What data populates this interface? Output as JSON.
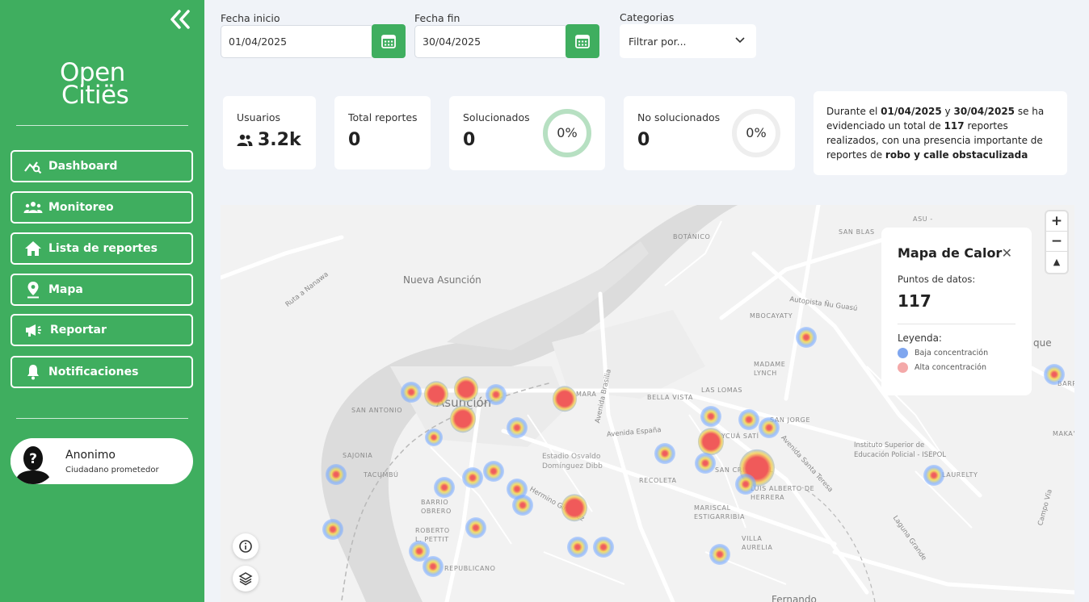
{
  "sidebar": {
    "logo_line1": "Open",
    "logo_line2": "Citiës",
    "items": [
      {
        "label": "Dashboard",
        "icon": "chart-search-icon"
      },
      {
        "label": "Monitoreo",
        "icon": "users-icon"
      },
      {
        "label": "Lista de reportes",
        "icon": "home-icon"
      },
      {
        "label": "Mapa",
        "icon": "map-pin-icon"
      },
      {
        "label": "Reportar",
        "icon": "megaphone-icon"
      },
      {
        "label": "Notificaciones",
        "icon": "bell-icon"
      }
    ],
    "user": {
      "name": "Anonimo",
      "role": "Ciudadano prometedor"
    }
  },
  "filters": {
    "start_label": "Fecha inicio",
    "start_value": "01/04/2025",
    "end_label": "Fecha fin",
    "end_value": "30/04/2025",
    "category_label": "Categorias",
    "category_value": "Filtrar por..."
  },
  "stats": {
    "users_label": "Usuarios",
    "users_value": "3.2k",
    "total_label": "Total reportes",
    "total_value": "0",
    "solved_label": "Solucionados",
    "solved_value": "0",
    "solved_pct": "0%",
    "unsolved_label": "No solucionados",
    "unsolved_value": "0",
    "unsolved_pct": "0%"
  },
  "summary": {
    "p1": "Durante el ",
    "d1": "01/04/2025",
    "p2": " y ",
    "d2": "30/04/2025",
    "p3": " se ha evidenciado un total de ",
    "count": "117",
    "p4": " reportes realizados, con una presencia importante de reportes de ",
    "cats": "robo y calle obstaculizada"
  },
  "map": {
    "legend_title": "Mapa de Calor",
    "points_label": "Puntos de datos:",
    "points_value": "117",
    "legend_heading": "Leyenda:",
    "low_label": "Baja concentración",
    "high_label": "Alta concentración",
    "low_color": "#7fa6ef",
    "high_color": "#f4a9a9",
    "zoom_in": "+",
    "zoom_out": "−",
    "reset": "▲",
    "labels": {
      "nueva_asuncion": "Nueva Asunción",
      "asuncion": "Asunción",
      "botanico": "BOTÁNICO",
      "san_blas": "SAN BLAS",
      "asu": "ASU -",
      "mbocayaty": "MBOCAYATY",
      "madame_lynch": "MADAME LYNCH",
      "las_lomas": "LAS LOMAS",
      "bella_vista": "BELLA VISTA",
      "san_antonio": "SAN ANTONIO",
      "san_jorge": "SAN JORGE",
      "sajonia": "SAJONIA",
      "tacumbu": "TACUMBÚ",
      "barrio_obrero": "BARRIO OBRERO",
      "roberto_petit": "ROBERTO L. PETTIT",
      "republicano": "REPUBLICANO",
      "recoleta": "RECOLETA",
      "mariscal": "MARISCAL ESTIGARRIBIA",
      "luis_alberto": "LUIS ALBERTO DE HERRERA",
      "villa_aurelia": "VILLA AURELIA",
      "san_cristobal": "SAN CRISTÓBAL",
      "laurelty": "LAURELTY",
      "maka": "MAKA'I",
      "mara": "MARA",
      "ycua_sati": "YCUÁ SATÍ",
      "isepol": "Instituto Superior de Educación Policial - ISEPOL",
      "estadio": "Estadio Osvaldo Domínguez Dibb",
      "av_espana": "Avenida España",
      "av_brasilia": "Avenida Brasilia",
      "av_santa_teresa": "Avenida Santa Teresa",
      "autopista": "Autopista Ñu Guasú",
      "ruta_nanawa": "Ruta a Nanawa",
      "hermino": "Hermino Giménez",
      "laguna_grande": "Laguna Grande",
      "campo_via": "Campo Vía",
      "fernando": "Fernando",
      "que": "que",
      "barrio": "BARRIO"
    }
  }
}
